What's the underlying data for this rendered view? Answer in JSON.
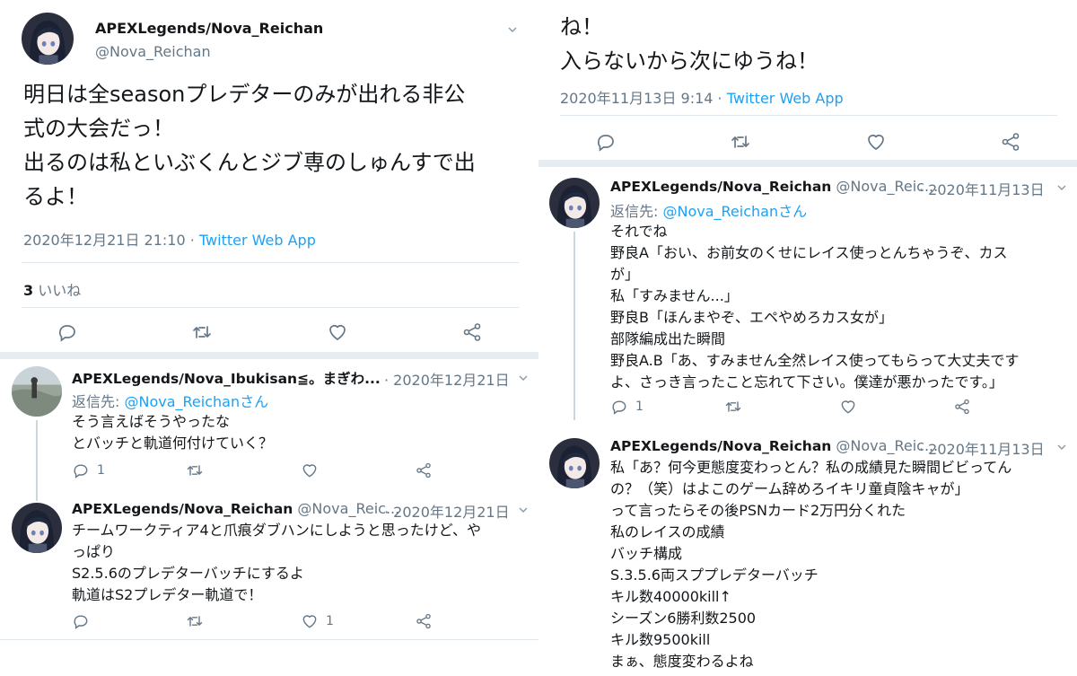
{
  "left": {
    "main": {
      "name": "APEXLegends/Nova_Reichan",
      "handle": "@Nova_Reichan",
      "text": "明日は全seasonプレデターのみが出れる非公\n式の大会だっ！\n出るのは私といぶくんとジブ専のしゅんすで出\nるよ！",
      "date": "2020年12月21日 21:10",
      "source_sep": " · ",
      "source": "Twitter Web App",
      "like_count": "3",
      "like_label": "いいね"
    },
    "reply1": {
      "name": "APEXLegends/Nova_Ibukisan≦。まぎわ...",
      "date": "· 2020年12月21日",
      "reply_prefix": "返信先: ",
      "reply_to": "@Nova_Reichanさん",
      "text": "そう言えばそうやったな\nとバッチと軌道何付けていく？",
      "reply_count": "1"
    },
    "reply2": {
      "name": "APEXLegends/Nova_Reichan",
      "handle": "@Nova_Reic...",
      "date": "· 2020年12月21日",
      "text": "チームワークティア4と爪痕ダブハンにしようと思ったけど、や\nっぱり\nS2.5.6のプレデターバッチにするよ\n軌道はS2プレデター軌道で！",
      "like_count": "1"
    }
  },
  "right": {
    "top": {
      "text": "ね！\n入らないから次にゆうね！",
      "date": "2020年11月13日 9:14",
      "source_sep": " · ",
      "source": "Twitter Web App"
    },
    "reply1": {
      "name": "APEXLegends/Nova_Reichan",
      "handle": "@Nova_Reic...",
      "date": "· 2020年11月13日",
      "reply_prefix": "返信先: ",
      "reply_to": "@Nova_Reichanさん",
      "text": "それでね\n野良A「おい、お前女のくせにレイス使っとんちゃうぞ、カス\nが」\n私「すみません...」\n野良B「ほんまやぞ、エペやめろカス女が」\n部隊編成出た瞬間\n野良A.B「あ、すみません全然レイス使ってもらって大丈夫です\nよ、さっき言ったこと忘れて下さい。僕達が悪かったです。」",
      "reply_count": "1"
    },
    "reply2": {
      "name": "APEXLegends/Nova_Reichan",
      "handle": "@Nova_Reic...",
      "date": "· 2020年11月13日",
      "text": "私「あ？何今更態度変わっとん？私の成績見た瞬間ビビってん\nの？（笑）はよこのゲーム辞めろイキリ童貞陰キャが」\nって言ったらその後PSNカード2万円分くれた\n私のレイスの成績\nバッチ構成\nS.3.5.6両スププレデターバッチ\nキル数40000kill↑\nシーズン6勝利数2500\nキル数9500kill\nまぁ、態度変わるよね"
    }
  },
  "colors": {
    "accent": "#1da1f2",
    "muted": "#657786",
    "text": "#14171a",
    "divider": "#e1e8ed"
  },
  "icons": [
    "avatar-anime-girl",
    "avatar-landscape",
    "reply-icon",
    "retweet-icon",
    "like-icon",
    "share-icon",
    "chevron-down-icon"
  ]
}
